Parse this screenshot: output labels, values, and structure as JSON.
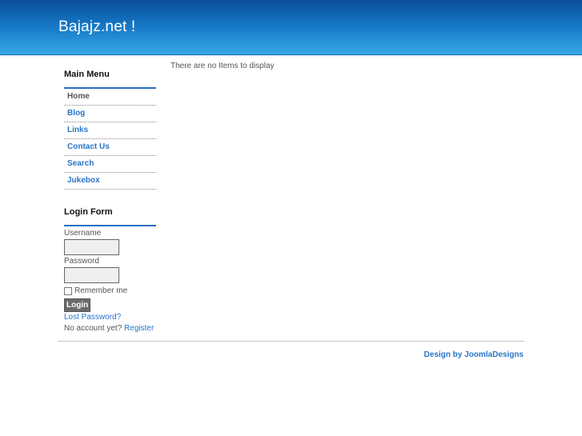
{
  "header": {
    "site_title": "Bajajz.net !"
  },
  "main_menu": {
    "title": "Main Menu",
    "items": [
      {
        "label": "Home"
      },
      {
        "label": "Blog"
      },
      {
        "label": "Links"
      },
      {
        "label": "Contact Us"
      },
      {
        "label": "Search"
      },
      {
        "label": "Jukebox"
      }
    ],
    "active_item": "Home"
  },
  "login_form": {
    "title": "Login Form",
    "username_label": "Username",
    "username_value": "",
    "password_label": "Password",
    "password_value": "",
    "remember_label": "Remember me",
    "login_button": "Login",
    "lost_password": "Lost Password?",
    "no_account": "No account yet?",
    "register": "Register"
  },
  "content": {
    "message": "There are no Items to display"
  },
  "footer": {
    "credit": "Design by JoomlaDesigns"
  },
  "colors": {
    "link": "#2a74c8",
    "header_top": "#0a4f9a",
    "header_bottom": "#35a7e6"
  }
}
